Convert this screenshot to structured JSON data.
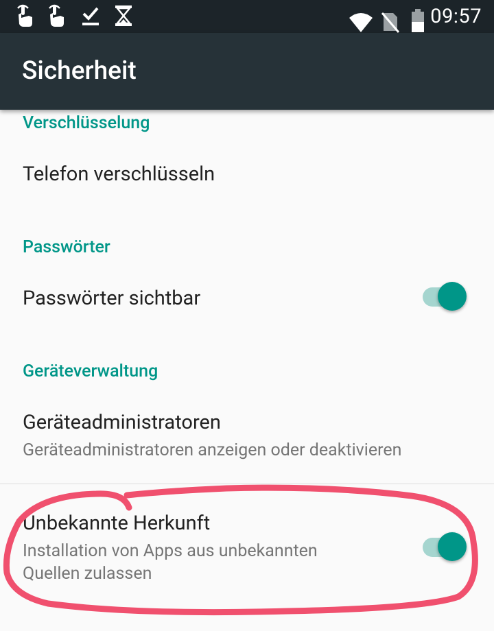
{
  "status_bar": {
    "time": "09:57",
    "left_icons": [
      "touch-hand-icon",
      "touch-hand-icon",
      "download-done-icon",
      "hourglass-icon"
    ],
    "right_icons": [
      "wifi-icon",
      "no-sim-icon",
      "battery-icon"
    ]
  },
  "app_bar": {
    "title": "Sicherheit"
  },
  "sections": {
    "encryption": {
      "header": "Verschlüsselung",
      "item_title": "Telefon verschlüsseln"
    },
    "passwords": {
      "header": "Passwörter",
      "item_title": "Passwörter sichtbar",
      "switch_on": true
    },
    "device_admin": {
      "header": "Geräteverwaltung",
      "admins_title": "Geräteadministratoren",
      "admins_summary": "Geräteadministratoren anzeigen oder deaktivieren",
      "unknown_title": "Unbekannte Herkunft",
      "unknown_summary_line1": "Installation von Apps aus unbekannten",
      "unknown_summary_line2": "Quellen zulassen",
      "unknown_switch_on": true
    }
  },
  "colors": {
    "accent": "#009688",
    "toolbar": "#263238",
    "status_bar": "#1c2429",
    "annotation": "#f0506e"
  }
}
